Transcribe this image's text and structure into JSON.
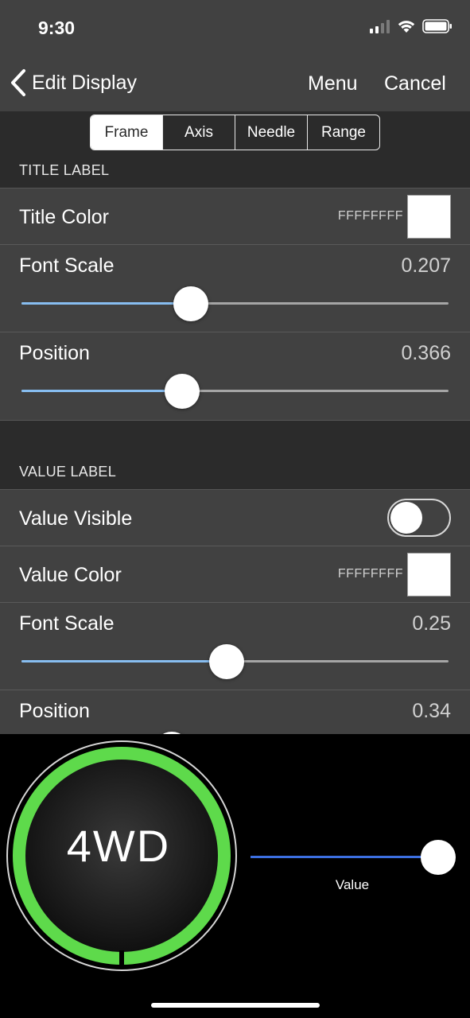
{
  "status_bar": {
    "time": "9:30"
  },
  "nav": {
    "back_label": "Edit Display",
    "menu_label": "Menu",
    "cancel_label": "Cancel"
  },
  "tabs": [
    {
      "label": "Frame",
      "active": true
    },
    {
      "label": "Axis",
      "active": false
    },
    {
      "label": "Needle",
      "active": false
    },
    {
      "label": "Range",
      "active": false
    }
  ],
  "title_label": {
    "header": "TITLE LABEL",
    "color_label": "Title Color",
    "color_hex": "FFFFFFFF",
    "color_swatch": "#FFFFFF",
    "font_scale_label": "Font Scale",
    "font_scale_value": "0.207",
    "font_scale_fraction": 0.397,
    "position_label": "Position",
    "position_value": "0.366",
    "position_fraction": 0.376
  },
  "value_label": {
    "header": "VALUE LABEL",
    "visible_label": "Value Visible",
    "visible_on": false,
    "color_label": "Value Color",
    "color_hex": "FFFFFFFF",
    "color_swatch": "#FFFFFF",
    "font_scale_label": "Font Scale",
    "font_scale_value": "0.25",
    "font_scale_fraction": 0.48,
    "position_label": "Position",
    "position_value": "0.34"
  },
  "preview": {
    "gauge_text": "4WD",
    "gauge_ring_color": "#5EDA4B",
    "slider_label": "Value",
    "slider_fraction": 1.0
  },
  "colors": {
    "panel_bg": "#414141",
    "section_bg": "#2B2B2B",
    "slider_fill": "#87BDF0",
    "preview_slider_fill": "#3C6FE0"
  }
}
